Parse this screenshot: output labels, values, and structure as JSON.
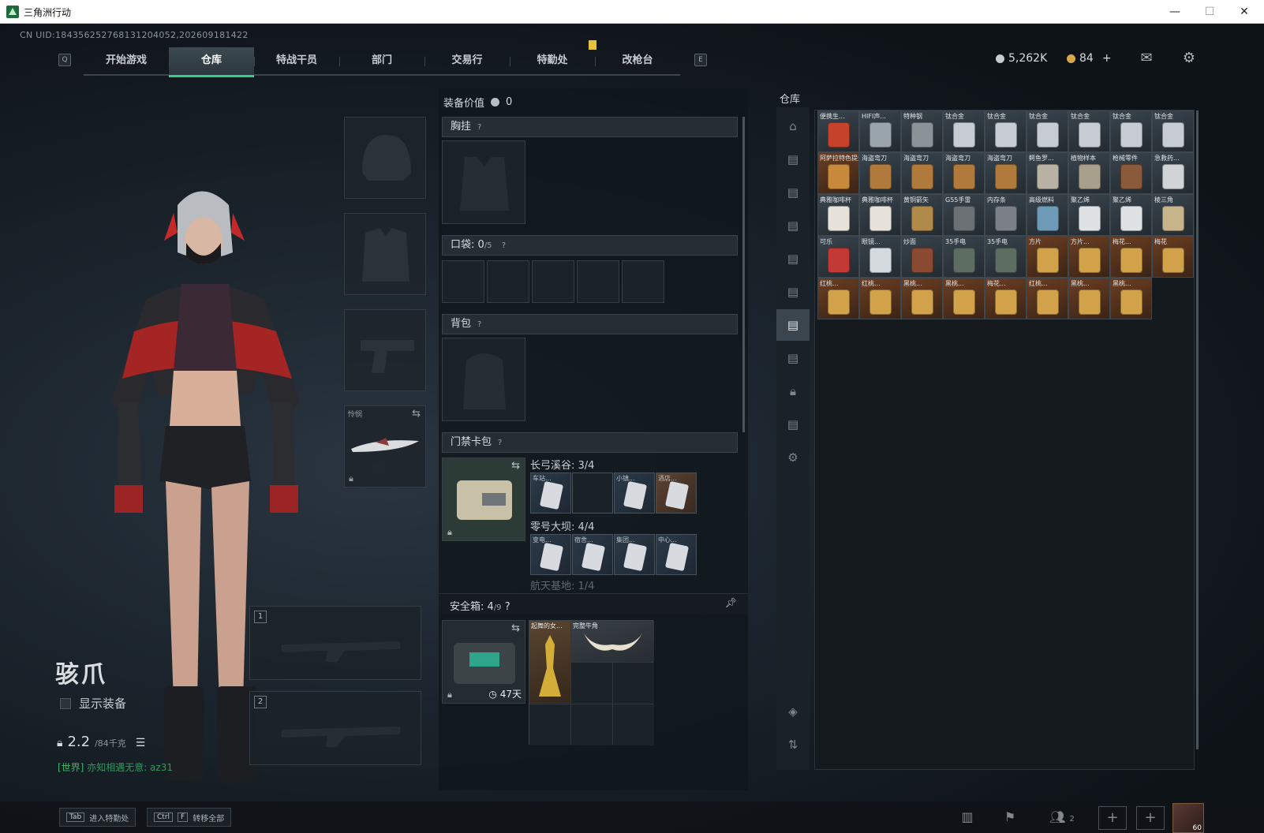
{
  "window": {
    "title": "三角洲行动",
    "minimize": "—",
    "maximize": "☐",
    "close": "✕"
  },
  "uid": "CN UID:184356252768131204052,202609181422",
  "nav": {
    "key_left": "Q",
    "key_right": "E",
    "tabs": [
      "开始游戏",
      "仓库",
      "特战干员",
      "部门",
      "交易行",
      "特勤处",
      "改枪台"
    ],
    "active_tab": "仓库"
  },
  "currencies": {
    "money": "5,262K",
    "coins": "84",
    "add": "+"
  },
  "character": {
    "name": "骇爪",
    "show_equipment": "显示装备",
    "weight_value": "2.2",
    "weight_max": "/84千克",
    "chat_channel": "[世界]",
    "chat_message": "亦知相遇无意: az31"
  },
  "equip_slots": {
    "melee_label": "怜悯"
  },
  "weapon_slots": [
    "1",
    "2"
  ],
  "mid": {
    "equip_value_label": "装备价值",
    "equip_value": "0",
    "chest_rig": "胸挂",
    "pockets_label": "口袋:",
    "pockets_used": "0",
    "pockets_max": "/5",
    "backpack": "背包",
    "keycard_case": "门禁卡包",
    "map1_title": "长弓溪谷: 3/4",
    "map1_cards": [
      "车站...",
      "",
      "小镇...",
      "酒店..."
    ],
    "map2_title": "零号大坝: 4/4",
    "map2_cards": [
      "变电...",
      "宿舍...",
      "集团...",
      "中心..."
    ],
    "map3_title": "航天基地: 1/4",
    "safe_box_label": "安全箱:",
    "safe_box_used": "4",
    "safe_box_max": "/9",
    "safe_box_timer": "47天",
    "safe_items": [
      "起舞的女...",
      "完整牛角"
    ],
    "question": "?"
  },
  "warehouse": {
    "title": "仓库",
    "items": [
      {
        "n": "便携生...",
        "c": "#c7422a",
        "r": ""
      },
      {
        "n": "HIFI声...",
        "c": "#9aa4ad",
        "r": ""
      },
      {
        "n": "特种钢",
        "c": "#8b9399",
        "r": ""
      },
      {
        "n": "钛合金",
        "c": "#c6ccd1",
        "r": ""
      },
      {
        "n": "钛合金",
        "c": "#c6ccd1",
        "r": ""
      },
      {
        "n": "钛合金",
        "c": "#c6ccd1",
        "r": ""
      },
      {
        "n": "钛合金",
        "c": "#c6ccd1",
        "r": ""
      },
      {
        "n": "钛合金",
        "c": "#c6ccd1",
        "r": ""
      },
      {
        "n": "钛合金",
        "c": "#c6ccd1",
        "r": ""
      },
      {
        "n": "阿萨拉特色提灯",
        "c": "#c8893a",
        "r": "orange"
      },
      {
        "n": "海盗弯刀",
        "c": "#b07a3c",
        "r": ""
      },
      {
        "n": "海盗弯刀",
        "c": "#b07a3c",
        "r": ""
      },
      {
        "n": "海盗弯刀",
        "c": "#b07a3c",
        "r": ""
      },
      {
        "n": "海盗弯刀",
        "c": "#b07a3c",
        "r": ""
      },
      {
        "n": "鳄鱼罗...",
        "c": "#b8b2a4",
        "r": ""
      },
      {
        "n": "植物样本",
        "c": "#a8a08c",
        "r": ""
      },
      {
        "n": "枪械零件",
        "c": "#8a5a3a",
        "r": ""
      },
      {
        "n": "急救药...",
        "c": "#d0d4d6",
        "r": ""
      },
      {
        "n": "典雅咖啡杯",
        "c": "#e6e2da",
        "r": ""
      },
      {
        "n": "典雅咖啡杯",
        "c": "#e6e2da",
        "r": ""
      },
      {
        "n": "黄铜箭矢",
        "c": "#b08a48",
        "r": ""
      },
      {
        "n": "G55手雷",
        "c": "#6b7074",
        "r": ""
      },
      {
        "n": "内存条",
        "c": "#7a8086",
        "r": ""
      },
      {
        "n": "高级燃料",
        "c": "#6f9ab8",
        "r": ""
      },
      {
        "n": "聚乙烯",
        "c": "#dfe2e4",
        "r": ""
      },
      {
        "n": "聚乙烯",
        "c": "#dfe2e4",
        "r": ""
      },
      {
        "n": "棱三角",
        "c": "#c8b48a",
        "r": ""
      },
      {
        "n": "可乐",
        "c": "#c33a34",
        "r": ""
      },
      {
        "n": "眼镜...",
        "c": "#d4dade",
        "r": ""
      },
      {
        "n": "炒面",
        "c": "#8a4a32",
        "r": ""
      },
      {
        "n": "35手电",
        "c": "#5d6d62",
        "r": ""
      },
      {
        "n": "35手电",
        "c": "#5d6d62",
        "r": ""
      },
      {
        "n": "方片",
        "c": "#d2a24a",
        "r": "orange"
      },
      {
        "n": "方片...",
        "c": "#d2a24a",
        "r": "orange"
      },
      {
        "n": "梅花...",
        "c": "#d2a24a",
        "r": "orange"
      },
      {
        "n": "梅花",
        "c": "#d2a24a",
        "r": "orange"
      },
      {
        "n": "红桃...",
        "c": "#d2a24a",
        "r": "orange"
      },
      {
        "n": "红桃...",
        "c": "#d2a24a",
        "r": "orange"
      },
      {
        "n": "黑桃...",
        "c": "#d2a24a",
        "r": "orange"
      },
      {
        "n": "黑桃...",
        "c": "#d2a24a",
        "r": "orange"
      },
      {
        "n": "梅花...",
        "c": "#d2a24a",
        "r": "orange"
      },
      {
        "n": "红桃...",
        "c": "#d2a24a",
        "r": "orange"
      },
      {
        "n": "黑桃...",
        "c": "#d2a24a",
        "r": "orange"
      },
      {
        "n": "黑桃...",
        "c": "#d2a24a",
        "r": "orange"
      }
    ]
  },
  "bottom": {
    "hint1_key": "Tab",
    "hint1_text": "进入特勤处",
    "hint2_key1": "Ctrl",
    "hint2_key2": "F",
    "hint2_text": "转移全部",
    "friends_count": "2",
    "avatar_level": "60"
  }
}
